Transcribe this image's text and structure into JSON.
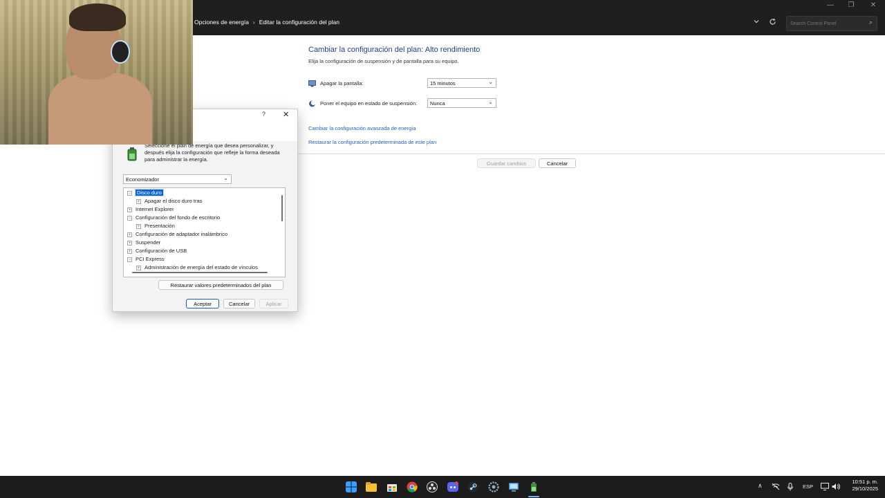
{
  "window": {
    "controls": {
      "minimize": "—",
      "maximize": "❐",
      "close": "✕"
    },
    "breadcrumb": [
      "Opciones de energía",
      "Editar la configuración del plan"
    ],
    "search": {
      "placeholder": "Search Control Panel"
    }
  },
  "plan_editor": {
    "title": "Cambiar la configuración del plan: Alto rendimiento",
    "subtitle": "Elija la configuración de suspensión y de pantalla para su equipo.",
    "settings": [
      {
        "label": "Apagar la pantalla:",
        "value": "15 minutos",
        "icon": "display-icon"
      },
      {
        "label": "Poner el equipo en estado de suspensión:",
        "value": "Nunca",
        "icon": "sleep-moon-icon"
      }
    ],
    "links": {
      "advanced": "Cambiar la configuración avanzada de energía",
      "restore": "Restaurar la configuración predeterminada de este plan"
    },
    "buttons": {
      "save": "Guardar cambios",
      "cancel": "Cancelar"
    }
  },
  "dialog": {
    "help": "?",
    "close": "✕",
    "instructions": "Seleccione el plan de energía que desea personalizar, y después elija la configuración que refleje la forma deseada para administrar la energía.",
    "plan_selected": "Economizador",
    "tree": [
      {
        "text": "Disco duro",
        "toggle": "−",
        "level": 0,
        "selected": true
      },
      {
        "text": "Apagar el disco duro tras",
        "toggle": "+",
        "level": 1,
        "selected": false
      },
      {
        "text": "Internet Explorer",
        "toggle": "+",
        "level": 0,
        "selected": false
      },
      {
        "text": "Configuración del fondo de escritorio",
        "toggle": "−",
        "level": 0,
        "selected": false
      },
      {
        "text": "Presentación",
        "toggle": "+",
        "level": 1,
        "selected": false
      },
      {
        "text": "Configuración de adaptador inalámbrico",
        "toggle": "+",
        "level": 0,
        "selected": false
      },
      {
        "text": "Suspender",
        "toggle": "+",
        "level": 0,
        "selected": false
      },
      {
        "text": "Configuración de USB",
        "toggle": "+",
        "level": 0,
        "selected": false
      },
      {
        "text": "PCI Express",
        "toggle": "−",
        "level": 0,
        "selected": false
      },
      {
        "text": "Administración de energía del estado de vínculos",
        "toggle": "+",
        "level": 1,
        "selected": false
      }
    ],
    "buttons": {
      "restore": "Restaurar valores predeterminados del plan",
      "ok": "Aceptar",
      "cancel": "Cancelar",
      "apply": "Aplicar"
    }
  },
  "taskbar": {
    "apps": [
      "windows-start-icon",
      "file-explorer-icon",
      "store-icon",
      "chrome-icon",
      "obs-icon",
      "discord-icon",
      "steam-icon",
      "settings-icon",
      "remote-desktop-icon",
      "power-battery-icon"
    ],
    "tray": {
      "chevron": "∧",
      "language": "ESP"
    },
    "clock": {
      "time": "10:51 p. m.",
      "date": "29/10/2025"
    }
  },
  "colors": {
    "titlebar": "#1f1f1f",
    "title_blue": "#1c3f95",
    "link_blue": "#1f5fbf",
    "selection": "#0a64d6",
    "taskbar": "#1c1c1c"
  }
}
